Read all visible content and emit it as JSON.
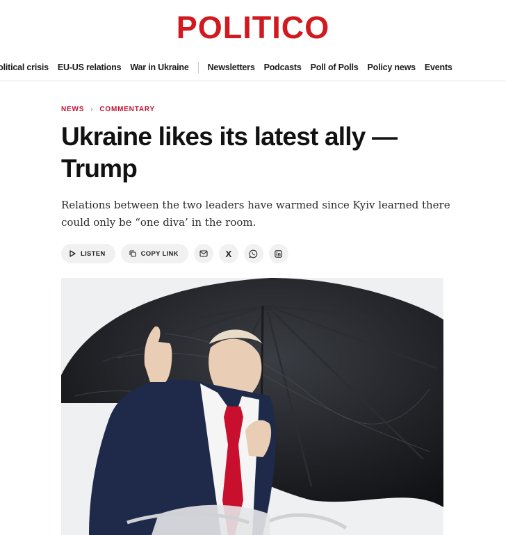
{
  "brand": {
    "logo_text": "POLITICO",
    "color": "#d11a1f"
  },
  "nav": {
    "items": [
      {
        "label": "Political crisis"
      },
      {
        "label": "EU-US relations"
      },
      {
        "label": "War in Ukraine"
      }
    ],
    "secondary": [
      {
        "label": "Newsletters"
      },
      {
        "label": "Podcasts"
      },
      {
        "label": "Poll of Polls"
      },
      {
        "label": "Policy news"
      },
      {
        "label": "Events"
      }
    ]
  },
  "breadcrumb": {
    "first": "NEWS",
    "second": "COMMENTARY",
    "color": "#c8102e"
  },
  "article": {
    "headline": "Ukraine likes its latest ally — Trump",
    "dek": "Relations between the two leaders have warmed since Kyiv learned there could only be “one diva’ in the room."
  },
  "actions": {
    "listen_label": "LISTEN",
    "copy_link_label": "COPY LINK",
    "share_icons": [
      "email-icon",
      "x-icon",
      "whatsapp-icon",
      "linkedin-icon"
    ],
    "x_glyph": "X"
  },
  "hero_image": {
    "subject": "man giving thumbs up under a large black umbrella, dark suit and red tie"
  }
}
